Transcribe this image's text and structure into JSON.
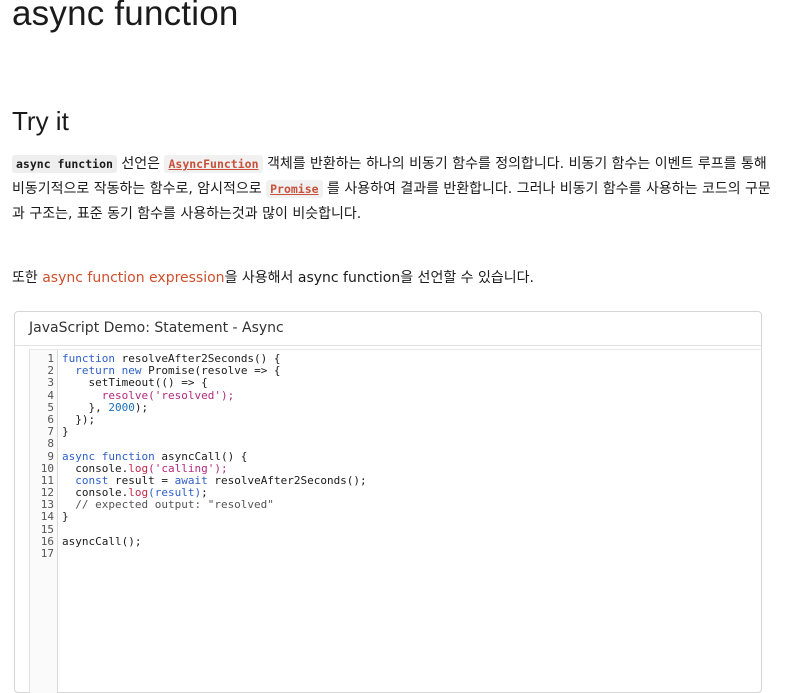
{
  "page": {
    "title": "async function",
    "section_title": "Try it"
  },
  "intro": {
    "code1": "async function",
    "text1": " 선언은 ",
    "link1": "AsyncFunction",
    "text2": " 객체를 반환하는 하나의 비동기 함수를 정의합니다. 비동기 함수는 이벤트 루프를 통해 비동기적으로 작동하는 함수로, 암시적으로 ",
    "link2": "Promise",
    "text3": " 를 사용하여 결과를 반환합니다. 그러나 비동기 함수를 사용하는 코드의 구문과 구조는, 표준 동기 함수를 사용하는것과 많이 비슷합니다."
  },
  "para2": {
    "text_before": "또한 ",
    "link": "async function expression",
    "text_after": "을 사용해서 async function을 선언할 수 있습니다."
  },
  "demo": {
    "title": "JavaScript Demo: Statement - Async",
    "line_numbers": [
      "1",
      "2",
      "3",
      "4",
      "5",
      "6",
      "7",
      "8",
      "9",
      "10",
      "11",
      "12",
      "13",
      "14",
      "15",
      "16",
      "17"
    ],
    "code_lines": [
      [
        [
          "kw",
          "function"
        ],
        [
          "fn",
          " resolveAfter2Seconds() {"
        ]
      ],
      [
        [
          "fn",
          "  "
        ],
        [
          "kw",
          "return new"
        ],
        [
          "fn",
          " Promise(resolve => {"
        ]
      ],
      [
        [
          "fn",
          "    setTimeout(() => {"
        ]
      ],
      [
        [
          "fn",
          "      "
        ],
        [
          "str",
          "resolve('resolved');"
        ]
      ],
      [
        [
          "fn",
          "    }, "
        ],
        [
          "num",
          "2000"
        ],
        [
          "fn",
          ");"
        ]
      ],
      [
        [
          "fn",
          "  });"
        ]
      ],
      [
        [
          "fn",
          "}"
        ]
      ],
      [
        [
          "fn",
          ""
        ]
      ],
      [
        [
          "kw",
          "async function"
        ],
        [
          "fn",
          " asyncCall() {"
        ]
      ],
      [
        [
          "fn",
          "  console."
        ],
        [
          "method",
          "log"
        ],
        [
          "str",
          "('calling');"
        ]
      ],
      [
        [
          "fn",
          "  "
        ],
        [
          "kw",
          "const"
        ],
        [
          "fn",
          " result = "
        ],
        [
          "kw",
          "await"
        ],
        [
          "fn",
          " resolveAfter2Seconds();"
        ]
      ],
      [
        [
          "fn",
          "  console."
        ],
        [
          "method",
          "log"
        ],
        [
          "kw",
          "(result)"
        ],
        [
          "fn",
          ";"
        ]
      ],
      [
        [
          "cm",
          "  // expected output: \"resolved\""
        ]
      ],
      [
        [
          "fn",
          "}"
        ]
      ],
      [
        [
          "fn",
          ""
        ]
      ],
      [
        [
          "fn",
          "asyncCall();"
        ]
      ],
      [
        [
          "fn",
          ""
        ]
      ]
    ]
  },
  "colors": {
    "link": "#cf4f2c",
    "keyword": "#2e5fc9",
    "string": "#b1297e",
    "border": "#d6d6d6"
  }
}
